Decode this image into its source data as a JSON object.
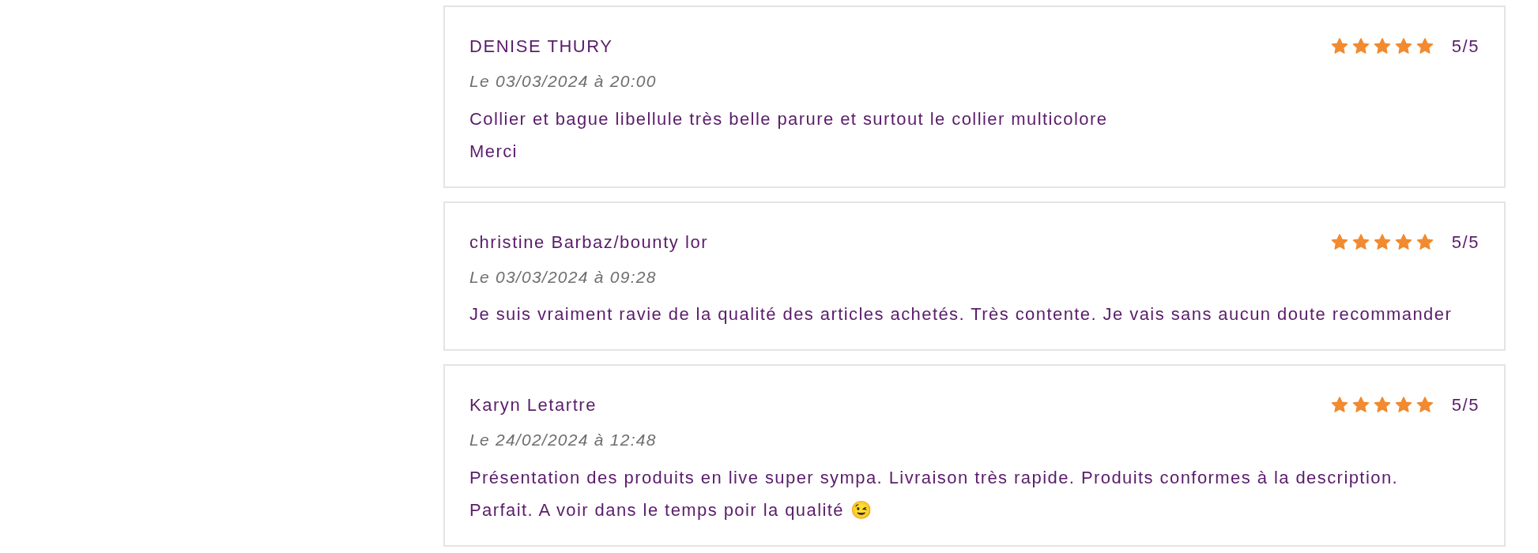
{
  "reviews": [
    {
      "author": "DENISE THURY",
      "date": "Le 03/03/2024 à 20:00",
      "stars": 5,
      "score": "5/5",
      "lines": [
        "Collier et bague libellule très belle parure et surtout le collier multicolore",
        "Merci"
      ]
    },
    {
      "author": "christine Barbaz/bounty lor",
      "date": "Le 03/03/2024 à 09:28",
      "stars": 5,
      "score": "5/5",
      "lines": [
        "Je suis vraiment ravie de la qualité des articles achetés. Très contente. Je vais sans aucun doute recommander"
      ]
    },
    {
      "author": "Karyn Letartre",
      "date": "Le 24/02/2024 à 12:48",
      "stars": 5,
      "score": "5/5",
      "lines": [
        "Présentation des produits en live super sympa. Livraison très rapide. Produits conformes à la description.",
        "Parfait. A voir dans le temps poir la qualité 😉"
      ]
    }
  ]
}
